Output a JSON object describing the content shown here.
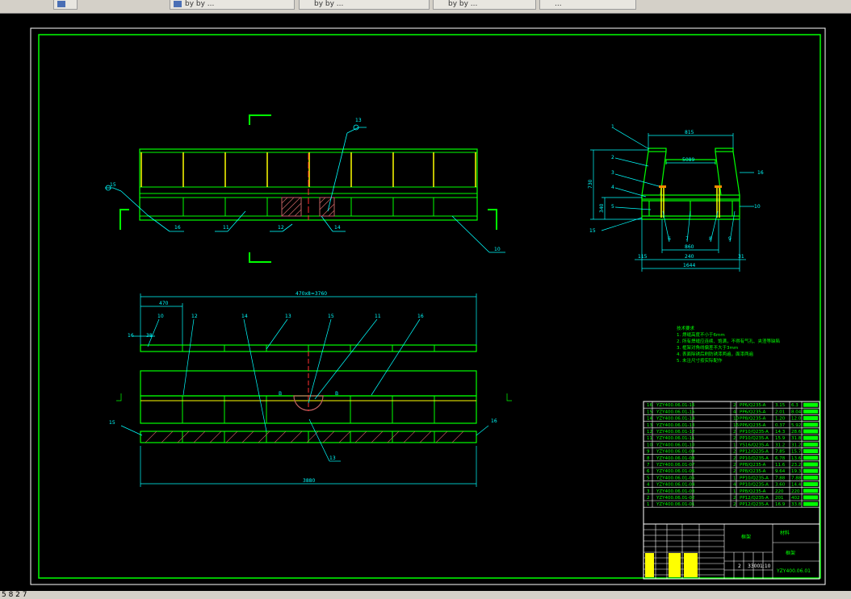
{
  "tabs": [
    {
      "label": ""
    },
    {
      "label": "by by ..."
    },
    {
      "label": "by by ..."
    },
    {
      "label": "by by ..."
    },
    {
      "label": "..."
    }
  ],
  "status": {
    "text": "5 8 2 7"
  },
  "drawing": {
    "colors": {
      "background": "#000000",
      "frame": "#00ff00",
      "steel": "#ffff00",
      "dim": "#00ffff",
      "cut": "#ff3030",
      "hatch": "#c06060"
    },
    "top_dims": {
      "width": "815",
      "inner": "5089",
      "side": "730",
      "lower": "340",
      "base": "860",
      "sub": "240",
      "total": "1644",
      "left": "115",
      "right": "31"
    },
    "plan_dims": {
      "top": "470x8=3760",
      "left": "470",
      "bottom": "3880"
    },
    "callouts_front": [
      "1",
      "2",
      "3",
      "4",
      "5",
      "6",
      "7",
      "8",
      "9"
    ],
    "callouts_plan": [
      "10",
      "12",
      "14",
      "13",
      "15",
      "11",
      "16"
    ],
    "notes_title": "技术要求",
    "notes": [
      "1. 焊缝高度不小于6mm",
      "2. 所有焊缝应连续、饱满，不得有气孔、夹渣等缺陷",
      "3. 框架对角线偏差不大于3mm",
      "4. 表面除锈后刷防锈漆两遍，面漆两遍",
      "5. 未注尺寸按实际配作"
    ],
    "bom": [
      {
        "no": "16",
        "code": "YZY400.06.01-16",
        "qty": "2",
        "mat": "PP6/Q235-A",
        "w1": "3.15",
        "w2": "6.3"
      },
      {
        "no": "15",
        "code": "YZY400.06.01-15",
        "qty": "4",
        "mat": "PP6/Q235-A",
        "w1": "2.01",
        "w2": "8.04"
      },
      {
        "no": "14",
        "code": "YZY400.06.01-14",
        "qty": "10",
        "mat": "PP8/Q235-A",
        "w1": "1.20",
        "w2": "12.0"
      },
      {
        "no": "13",
        "code": "YZY400.06.01-13",
        "qty": "16",
        "mat": "PP6/Q235-A",
        "w1": "0.37",
        "w2": "5.92"
      },
      {
        "no": "12",
        "code": "YZY400.06.01-12",
        "qty": "2",
        "mat": "PP10/Q235-A",
        "w1": "14.3",
        "w2": "28.6"
      },
      {
        "no": "11",
        "code": "YZY400.06.01-11",
        "qty": "2",
        "mat": "PP10/Q235-A",
        "w1": "15.9",
        "w2": "31.8"
      },
      {
        "no": "10",
        "code": "YZY400.06.01-10",
        "qty": "1",
        "mat": "YS16/Q235-A",
        "w1": "31.2",
        "w2": "31.2"
      },
      {
        "no": "9",
        "code": "YZY400.06.01-09",
        "qty": "2",
        "mat": "PP12/Q235-A",
        "w1": "7.85",
        "w2": "15.7"
      },
      {
        "no": "8",
        "code": "YZY400.06.01-08",
        "qty": "2",
        "mat": "PP10/Q235-A",
        "w1": "6.78",
        "w2": "13.6"
      },
      {
        "no": "7",
        "code": "YZY400.06.01-07",
        "qty": "2",
        "mat": "PP8/Q235-A",
        "w1": "11.6",
        "w2": "23.2"
      },
      {
        "no": "6",
        "code": "YZY400.06.01-06",
        "qty": "2",
        "mat": "PP8/Q235-A",
        "w1": "9.64",
        "w2": "19.3"
      },
      {
        "no": "5",
        "code": "YZY400.06.01-05",
        "qty": "1",
        "mat": "PP10/Q235-A",
        "w1": "7.88",
        "w2": "7.88"
      },
      {
        "no": "4",
        "code": "YZY400.06.01-04",
        "qty": "4",
        "mat": "PP10/Q235-A",
        "w1": "3.60",
        "w2": "14.4"
      },
      {
        "no": "3",
        "code": "YZY400.06.01-03",
        "qty": "1",
        "mat": "PP8/Q235-A",
        "w1": "220",
        "w2": "220"
      },
      {
        "no": "2",
        "code": "YZY400.06.01-02",
        "qty": "2",
        "mat": "PP12/Q235-A",
        "w1": "201",
        "w2": "402"
      },
      {
        "no": "1",
        "code": "YZY400.06.01-01",
        "qty": "2",
        "mat": "PP12/Q235-A",
        "w1": "16.9",
        "w2": "33.8"
      }
    ],
    "title_block": {
      "drawing_no": "YZY400.06.01",
      "name": "框架",
      "scale": "1:10",
      "sheets": "2",
      "weight": "3300"
    }
  }
}
